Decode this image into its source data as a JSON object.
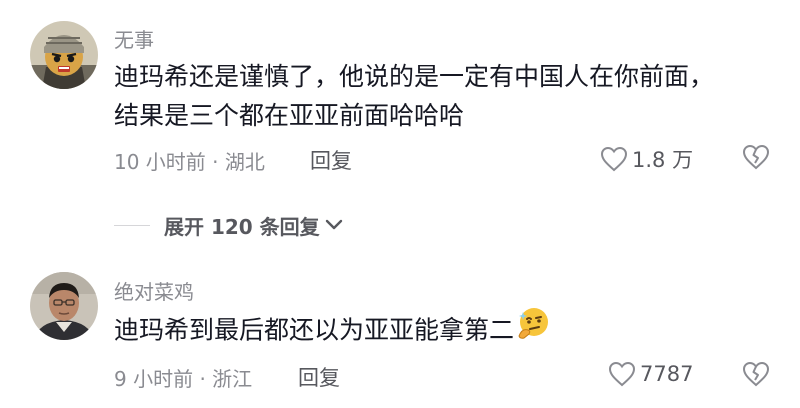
{
  "comments": [
    {
      "username": "无事",
      "text": "迪玛希还是谨慎了，他说的是一定有中国人在你前面，结果是三个都在亚亚前面哈哈哈",
      "time_location": "10 小时前 · 湖北",
      "reply_label": "回复",
      "like_count": "1.8 万",
      "avatar_icon": "cartoon-avatar-icon"
    },
    {
      "username": "绝对菜鸡",
      "text": "迪玛希到最后都还以为亚亚能拿第二",
      "emoji": "thinking-face-emoji",
      "time_location": "9 小时前 · 浙江",
      "reply_label": "回复",
      "like_count": "7787",
      "avatar_icon": "photo-avatar-icon"
    }
  ],
  "expand_replies": {
    "label": "展开 120 条回复"
  },
  "colors": {
    "primary_text": "#161823",
    "secondary_text": "#8a8b91",
    "action_text": "#57585e"
  }
}
